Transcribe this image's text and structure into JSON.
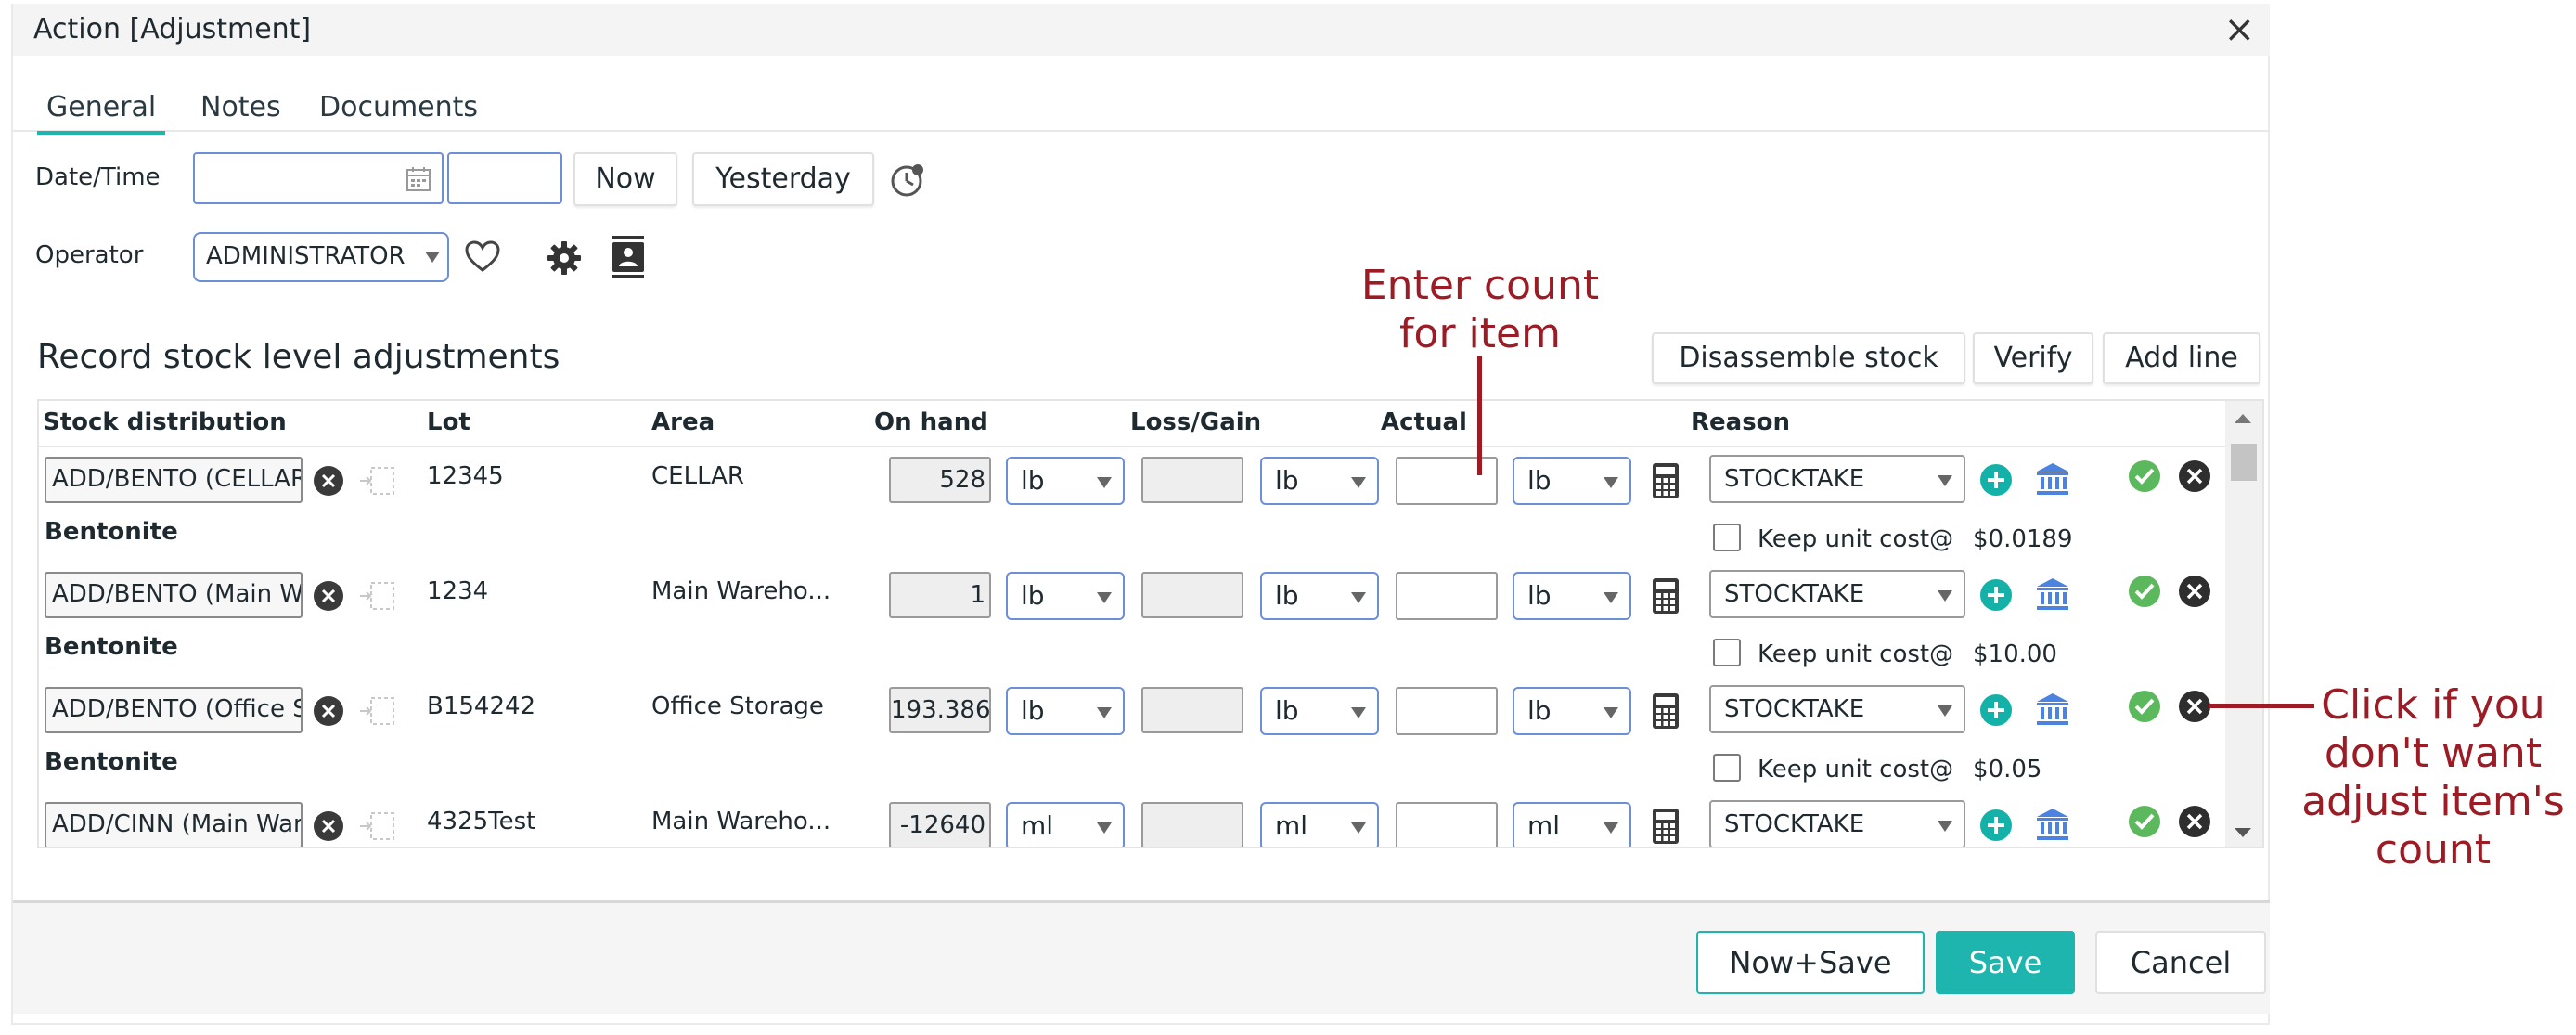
{
  "window": {
    "title": "Action [Adjustment]"
  },
  "tabs": [
    {
      "label": "General"
    },
    {
      "label": "Notes"
    },
    {
      "label": "Documents"
    }
  ],
  "form": {
    "datetime_label": "Date/Time",
    "now_label": "Now",
    "yesterday_label": "Yesterday",
    "operator_label": "Operator",
    "operator_value": "ADMINISTRATOR"
  },
  "section": {
    "title": "Record stock level adjustments"
  },
  "actions": {
    "disassemble": "Disassemble stock",
    "verify": "Verify",
    "add_line": "Add line"
  },
  "table": {
    "headers": {
      "stock_distribution": "Stock distribution",
      "lot": "Lot",
      "area": "Area",
      "on_hand": "On hand",
      "loss_gain": "Loss/Gain",
      "actual": "Actual",
      "reason": "Reason"
    },
    "rows": [
      {
        "dist": "ADD/BENTO (CELLAR)",
        "lot": "12345",
        "area": "CELLAR",
        "on_hand": "528",
        "on_hand_unit": "lb",
        "loss_unit": "lb",
        "actual_unit": "lb",
        "reason": "STOCKTAKE",
        "product": "Bentonite",
        "keep_label": "Keep unit cost@",
        "unit_cost": "$0.0189"
      },
      {
        "dist": "ADD/BENTO (Main Warehouse)",
        "lot": "1234",
        "area": "Main Wareho...",
        "on_hand": "1",
        "on_hand_unit": "lb",
        "loss_unit": "lb",
        "actual_unit": "lb",
        "reason": "STOCKTAKE",
        "product": "Bentonite",
        "keep_label": "Keep unit cost@",
        "unit_cost": "$10.00"
      },
      {
        "dist": "ADD/BENTO (Office Storage)",
        "lot": "B154242",
        "area": "Office Storage",
        "on_hand": "193.386",
        "on_hand_unit": "lb",
        "loss_unit": "lb",
        "actual_unit": "lb",
        "reason": "STOCKTAKE",
        "product": "Bentonite",
        "keep_label": "Keep unit cost@",
        "unit_cost": "$0.05"
      },
      {
        "dist": "ADD/CINN (Main Warehouse)",
        "lot": "4325Test",
        "area": "Main Wareho...",
        "on_hand": "-12640",
        "on_hand_unit": "ml",
        "loss_unit": "ml",
        "actual_unit": "ml",
        "reason": "STOCKTAKE"
      }
    ]
  },
  "footer": {
    "now_save": "Now+Save",
    "save": "Save",
    "cancel": "Cancel"
  },
  "annotations": {
    "count": "Enter count\nfor item",
    "remove": "Click if you\ndon't want\nadjust item's\ncount"
  },
  "colors": {
    "accent": "#1db5ad",
    "annotation": "#9b1c25",
    "field_border": "#6d8fd8",
    "add_icon": "#14b1a8",
    "verify_icon": "#5cb85c"
  }
}
